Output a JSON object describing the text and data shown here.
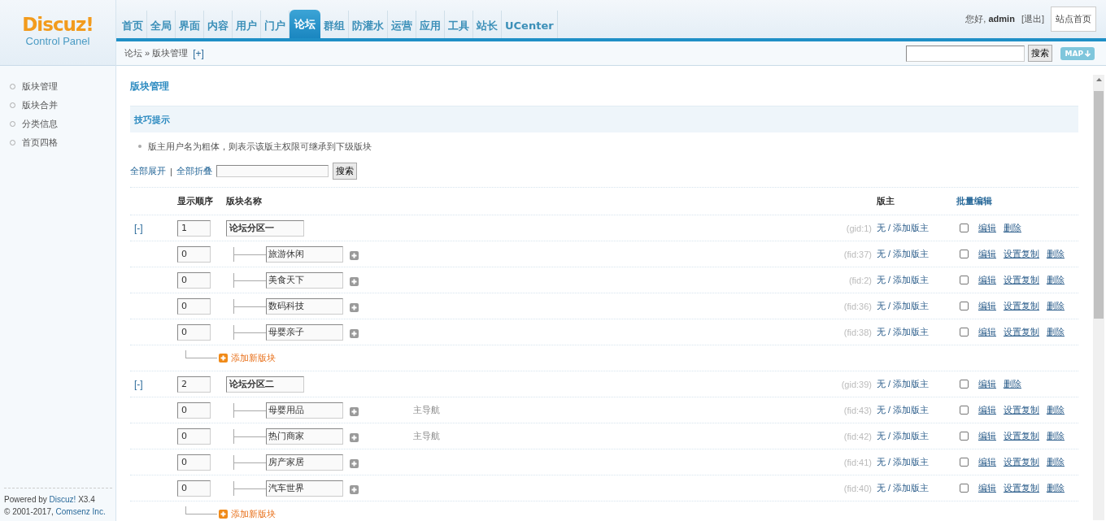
{
  "header": {
    "logo": "Discuz!",
    "logo_sub": "Control Panel",
    "greeting": "您好,",
    "user": "admin",
    "logout": "[退出]",
    "home_button": "站点首页",
    "nav": [
      {
        "label": "首页",
        "selected": false
      },
      {
        "label": "全局",
        "selected": false
      },
      {
        "label": "界面",
        "selected": false
      },
      {
        "label": "内容",
        "selected": false
      },
      {
        "label": "用户",
        "selected": false
      },
      {
        "label": "门户",
        "selected": false
      },
      {
        "label": "论坛",
        "selected": true
      },
      {
        "label": "群组",
        "selected": false
      },
      {
        "label": "防灌水",
        "selected": false
      },
      {
        "label": "运营",
        "selected": false
      },
      {
        "label": "应用",
        "selected": false
      },
      {
        "label": "工具",
        "selected": false
      },
      {
        "label": "站长",
        "selected": false
      },
      {
        "label": "UCenter",
        "selected": false
      }
    ]
  },
  "breadcrumb": {
    "path": "论坛 » 版块管理",
    "add": "[+]",
    "search_button": "搜索",
    "map_button": "MAP"
  },
  "sidebar": {
    "items": [
      {
        "label": "版块管理"
      },
      {
        "label": "版块合并"
      },
      {
        "label": "分类信息"
      },
      {
        "label": "首页四格"
      }
    ],
    "footer": {
      "powered": "Powered by",
      "brand": "Discuz!",
      "version": "X3.4",
      "copyright": "© 2001-2017,",
      "company": "Comsenz Inc."
    }
  },
  "main": {
    "title": "版块管理",
    "tips": {
      "title": "技巧提示",
      "items": [
        "版主用户名为粗体，则表示该版主权限可继承到下级版块"
      ]
    },
    "toolbar": {
      "expand_all": "全部展开",
      "separator": "|",
      "collapse_all": "全部折叠",
      "search_button": "搜索"
    },
    "table": {
      "columns": [
        "显示顺序",
        "版块名称",
        "版主",
        "批量编辑"
      ],
      "groups": [
        {
          "toggle": "[-]",
          "order": "1",
          "name": "论坛分区一",
          "id": "(gid:1)",
          "moderator": "无 / 添加版主",
          "checked": false,
          "actions": [
            "编辑",
            "删除"
          ],
          "add_forum": "添加新版块",
          "forums": [
            {
              "order": "0",
              "name": "旅游休闲",
              "id": "(fid:37)",
              "moderator": "无 / 添加版主",
              "checked": false,
              "actions": [
                "编辑",
                "设置复制",
                "删除"
              ]
            },
            {
              "order": "0",
              "name": "美食天下",
              "id": "(fid:2)",
              "moderator": "无 / 添加版主",
              "checked": false,
              "actions": [
                "编辑",
                "设置复制",
                "删除"
              ]
            },
            {
              "order": "0",
              "name": "数码科技",
              "id": "(fid:36)",
              "moderator": "无 / 添加版主",
              "checked": false,
              "actions": [
                "编辑",
                "设置复制",
                "删除"
              ]
            },
            {
              "order": "0",
              "name": "母婴亲子",
              "id": "(fid:38)",
              "moderator": "无 / 添加版主",
              "checked": false,
              "actions": [
                "编辑",
                "设置复制",
                "删除"
              ]
            }
          ]
        },
        {
          "toggle": "[-]",
          "order": "2",
          "name": "论坛分区二",
          "id": "(gid:39)",
          "moderator": "无 / 添加版主",
          "checked": false,
          "actions": [
            "编辑",
            "删除"
          ],
          "add_forum": "添加新版块",
          "forums": [
            {
              "order": "0",
              "name": "母婴用品",
              "nav": "主导航",
              "id": "(fid:43)",
              "moderator": "无 / 添加版主",
              "checked": false,
              "actions": [
                "编辑",
                "设置复制",
                "删除"
              ]
            },
            {
              "order": "0",
              "name": "热门商家",
              "nav": "主导航",
              "id": "(fid:42)",
              "moderator": "无 / 添加版主",
              "checked": false,
              "actions": [
                "编辑",
                "设置复制",
                "删除"
              ]
            },
            {
              "order": "0",
              "name": "房产家居",
              "id": "(fid:41)",
              "moderator": "无 / 添加版主",
              "checked": false,
              "actions": [
                "编辑",
                "设置复制",
                "删除"
              ]
            },
            {
              "order": "0",
              "name": "汽车世界",
              "id": "(fid:40)",
              "moderator": "无 / 添加版主",
              "checked": false,
              "actions": [
                "编辑",
                "设置复制",
                "删除"
              ]
            }
          ]
        }
      ]
    }
  }
}
